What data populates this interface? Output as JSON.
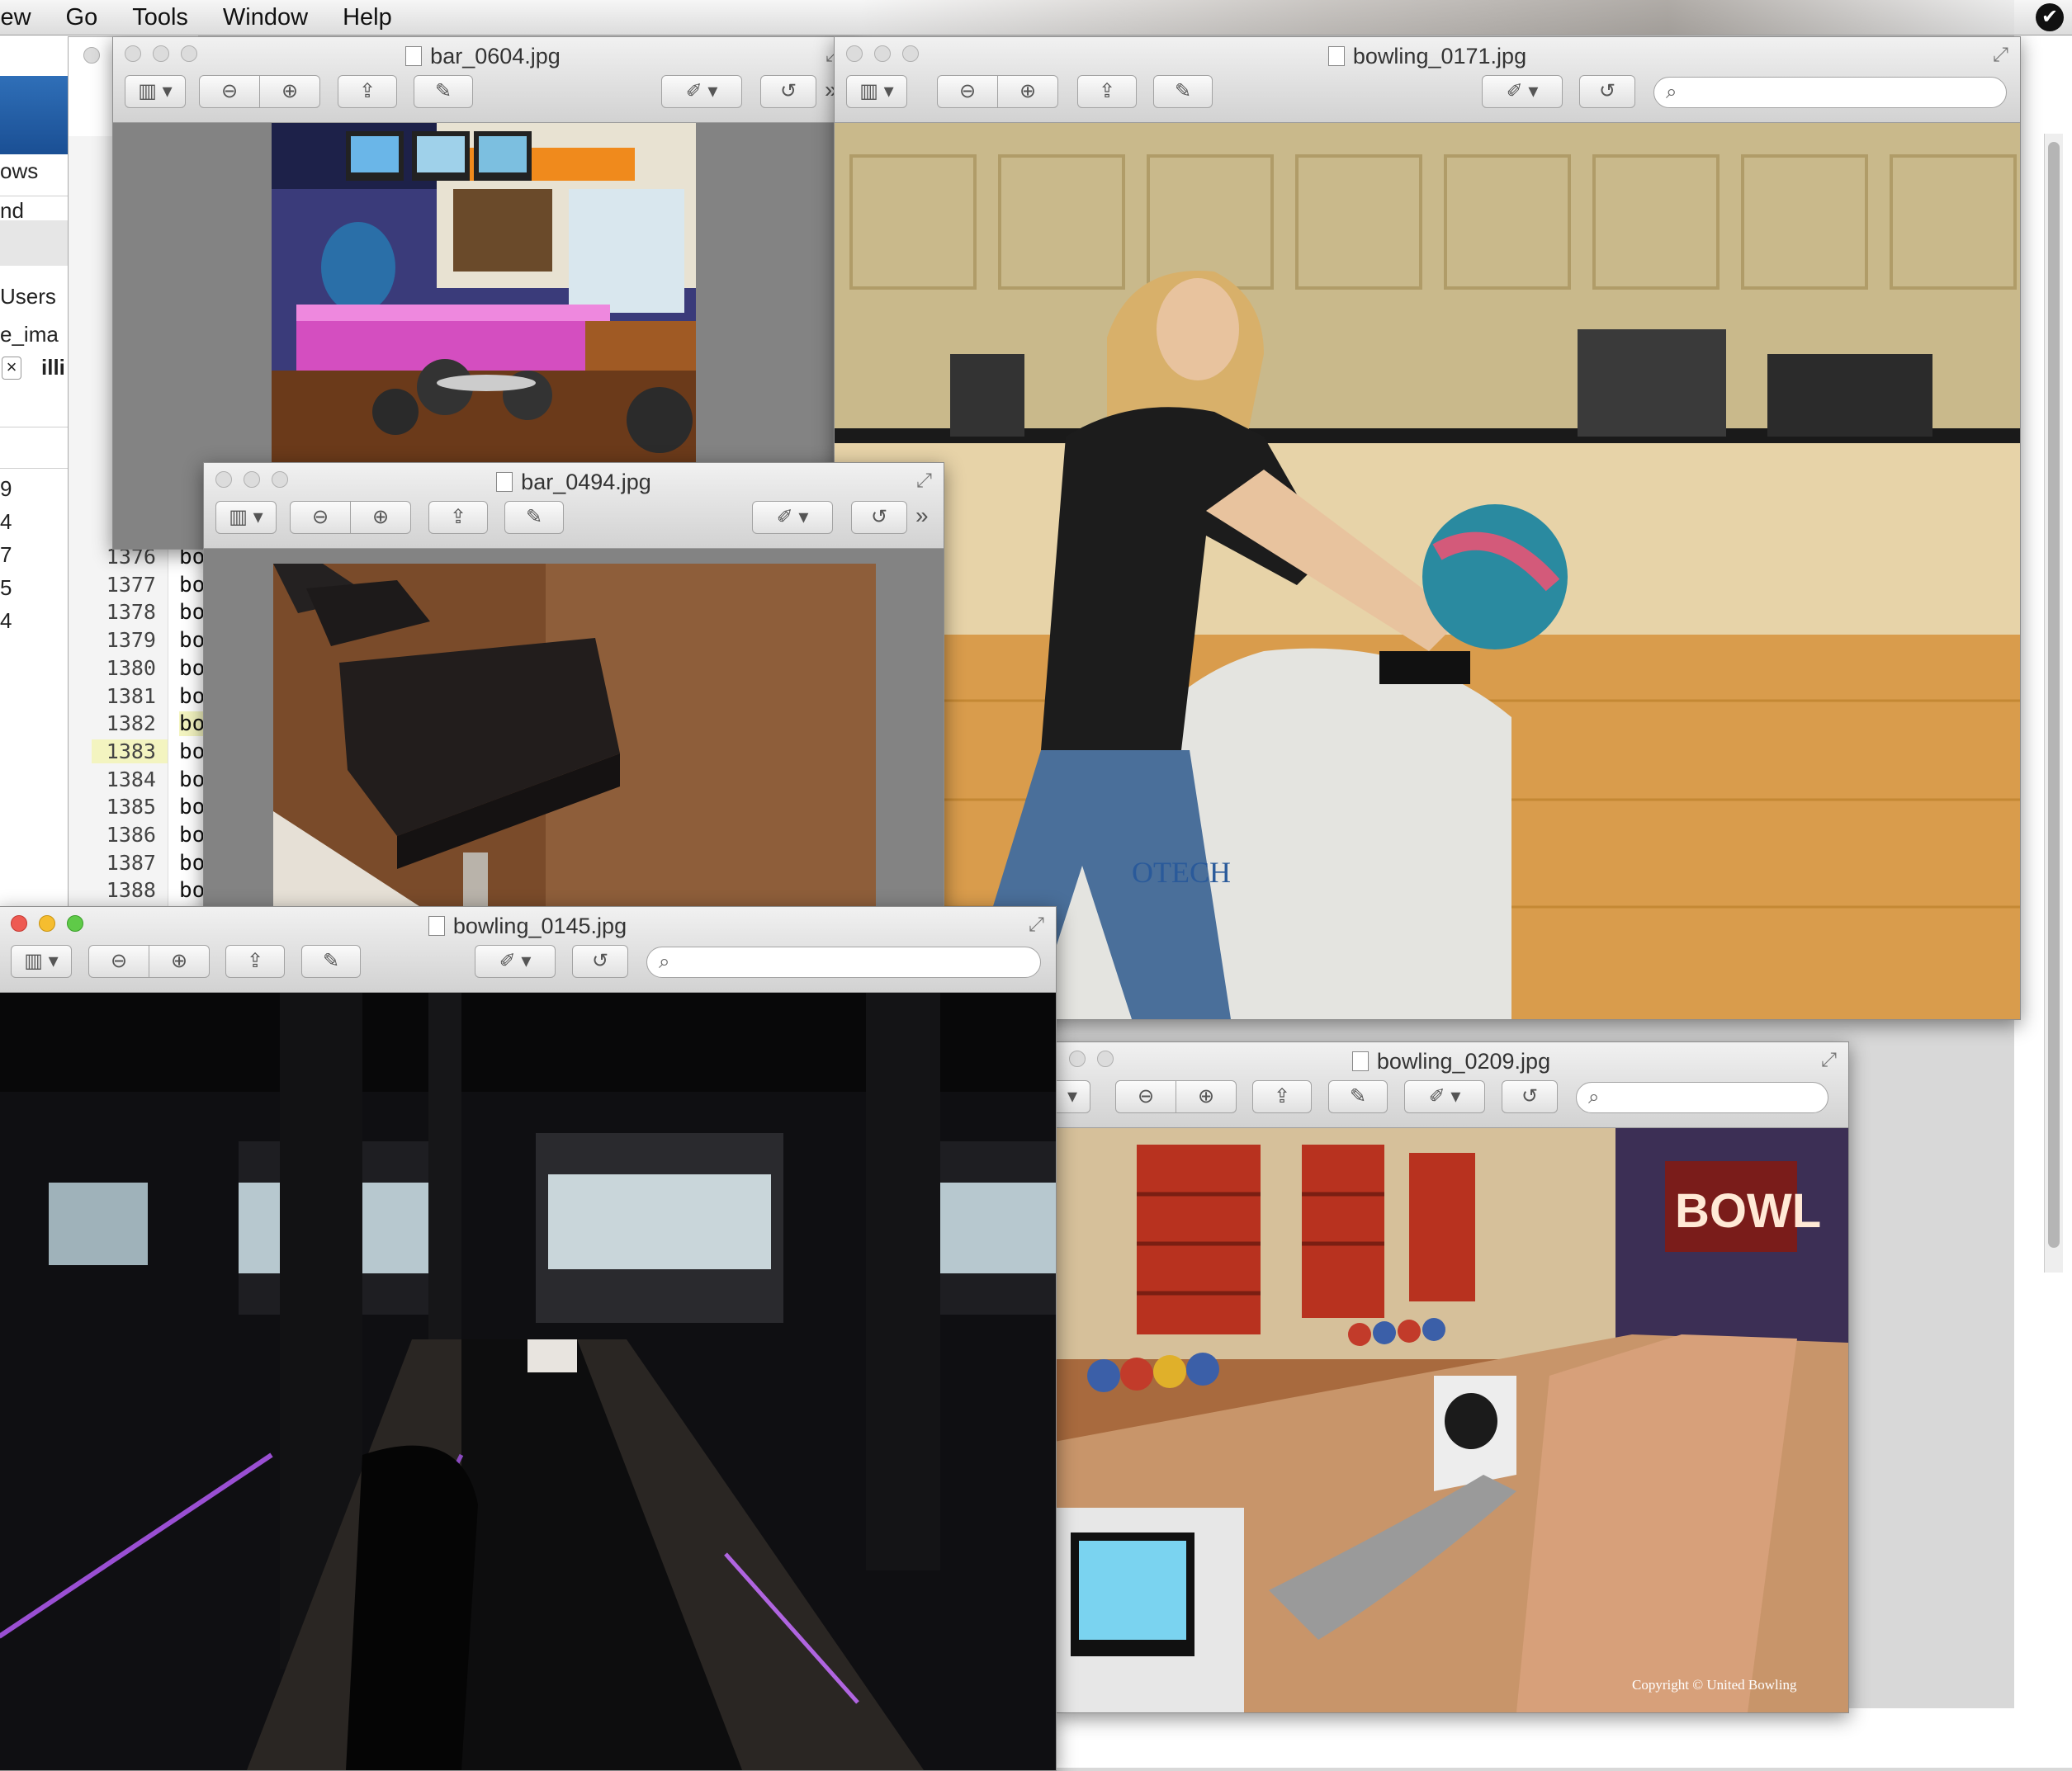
{
  "menubar": {
    "items": [
      "iew",
      "Go",
      "Tools",
      "Window",
      "Help"
    ]
  },
  "background_app": {
    "row1": "ows",
    "row2": "nd",
    "row3": "Users",
    "row4": "e_ima",
    "row5": "illi",
    "close_glyph": "×",
    "left_numbers": [
      "9",
      "4",
      "7",
      "5",
      "4"
    ]
  },
  "code_window": {
    "partial_lines": [
      "13",
      "13",
      "13",
      "13",
      "13",
      "13",
      "13",
      "13",
      "13",
      "13",
      "13",
      "13",
      "13",
      "13"
    ],
    "lines": [
      {
        "num": "1376",
        "text": "bo"
      },
      {
        "num": "1377",
        "text": "bo"
      },
      {
        "num": "1378",
        "text": "bo"
      },
      {
        "num": "1379",
        "text": "bo"
      },
      {
        "num": "1380",
        "text": "bo"
      },
      {
        "num": "1381",
        "text": "bo"
      },
      {
        "num": "1382",
        "text": "bo"
      },
      {
        "num": "1383",
        "text": "bo"
      },
      {
        "num": "1384",
        "text": "bo"
      },
      {
        "num": "1385",
        "text": "bo"
      },
      {
        "num": "1386",
        "text": "bo"
      },
      {
        "num": "1387",
        "text": "bo"
      },
      {
        "num": "1388",
        "text": "bo"
      }
    ],
    "highlighted_line": "1383"
  },
  "windows": {
    "bar_0604": {
      "title": "bar_0604.jpg"
    },
    "bowling_0171": {
      "title": "bowling_0171.jpg"
    },
    "bar_0494": {
      "title": "bar_0494.jpg"
    },
    "bowling_0145": {
      "title": "bowling_0145.jpg"
    },
    "bowling_0209": {
      "title": "bowling_0209.jpg"
    }
  },
  "photo_text": {
    "bowl_sign": "BOWL",
    "copyright": "Copyright © United Bowling",
    "ball_return_brand": "OTECH"
  },
  "icons": {
    "sidebar": "sidebar-icon",
    "zoom_out": "zoom-out-icon",
    "zoom_in": "zoom-in-icon",
    "share": "share-icon",
    "edit": "edit-icon",
    "annotate": "annotate-icon",
    "rotate": "rotate-icon",
    "search": "search-icon",
    "fullscreen": "fullscreen-icon",
    "overflow": "overflow-chevron-icon"
  },
  "colors": {
    "close": "#ee5a52",
    "minimize": "#f5bd2f",
    "zoom": "#5fca48",
    "line_highlight": "#f3f4c0"
  }
}
